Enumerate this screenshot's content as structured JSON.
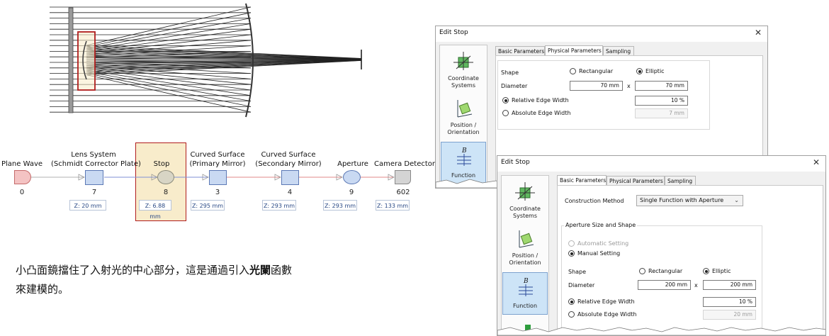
{
  "diagram": {
    "nodes": [
      {
        "title_l1": "",
        "title_l2": "Plane Wave",
        "id": "0",
        "z": ""
      },
      {
        "title_l1": "Lens System",
        "title_l2": "(Schmidt Corrector Plate)",
        "id": "7",
        "z": "Z: 20 mm"
      },
      {
        "title_l1": "",
        "title_l2": "Stop",
        "id": "8",
        "z": "Z: 6.88 mm"
      },
      {
        "title_l1": "Curved Surface",
        "title_l2": "(Primary Mirror)",
        "id": "3",
        "z": "Z: 295 mm"
      },
      {
        "title_l1": "Curved Surface",
        "title_l2": "(Secondary Mirror)",
        "id": "4",
        "z": "Z: 293 mm"
      },
      {
        "title_l1": "",
        "title_l2": "Aperture",
        "id": "9",
        "z": "Z: 293 mm"
      },
      {
        "title_l1": "",
        "title_l2": "Camera Detector",
        "id": "602",
        "z": "Z: 133 mm"
      }
    ]
  },
  "caption": {
    "line1_a": "小凸面鏡擋住了入射光的中心部分，這是通過引入",
    "line1_bold": "光闌",
    "line1_b": "函數",
    "line2": "來建模的。"
  },
  "dialog1": {
    "title": "Edit Stop",
    "close": "✕",
    "side_items": [
      "Coordinate Systems",
      "Position / Orientation",
      "Function"
    ],
    "tabs": [
      "Basic Parameters",
      "Physical Parameters",
      "Sampling"
    ],
    "active_tab": 1,
    "shape_label": "Shape",
    "shape_options": [
      "Rectangular",
      "Elliptic"
    ],
    "shape_selected": "Elliptic",
    "diameter_label": "Diameter",
    "diameter_x": "70 mm",
    "diameter_times": "x",
    "diameter_y": "70 mm",
    "rel_edge_label": "Relative Edge Width",
    "rel_edge_value": "10 %",
    "abs_edge_label": "Absolute Edge Width",
    "abs_edge_value": "7 mm"
  },
  "dialog2": {
    "title": "Edit Stop",
    "close": "✕",
    "side_items": [
      "Coordinate Systems",
      "Position / Orientation",
      "Function"
    ],
    "tabs": [
      "Basic Parameters",
      "Physical Parameters",
      "Sampling"
    ],
    "active_tab": 0,
    "construction_label": "Construction Method",
    "construction_value": "Single Function with Aperture",
    "group_title": "Aperture Size and Shape",
    "auto_setting": "Automatic Setting",
    "manual_setting": "Manual Setting",
    "shape_label": "Shape",
    "shape_options": [
      "Rectangular",
      "Elliptic"
    ],
    "shape_selected": "Elliptic",
    "diameter_label": "Diameter",
    "diameter_x": "200 mm",
    "diameter_times": "x",
    "diameter_y": "200 mm",
    "rel_edge_label": "Relative Edge Width",
    "rel_edge_value": "10 %",
    "abs_edge_label": "Absolute Edge Width",
    "abs_edge_value": "20 mm"
  },
  "colors": {
    "highlight_border": "#b01c1c",
    "highlight_fill": "#f8eccb",
    "ray_line": "#222222",
    "flow_blue": "#7f8fd4",
    "flow_red": "#e08a8a",
    "active_side": "#cde4f7"
  },
  "icons": [
    "coordinate-systems-icon",
    "position-orientation-icon",
    "function-icon",
    "close-icon",
    "chevron-down-icon"
  ]
}
